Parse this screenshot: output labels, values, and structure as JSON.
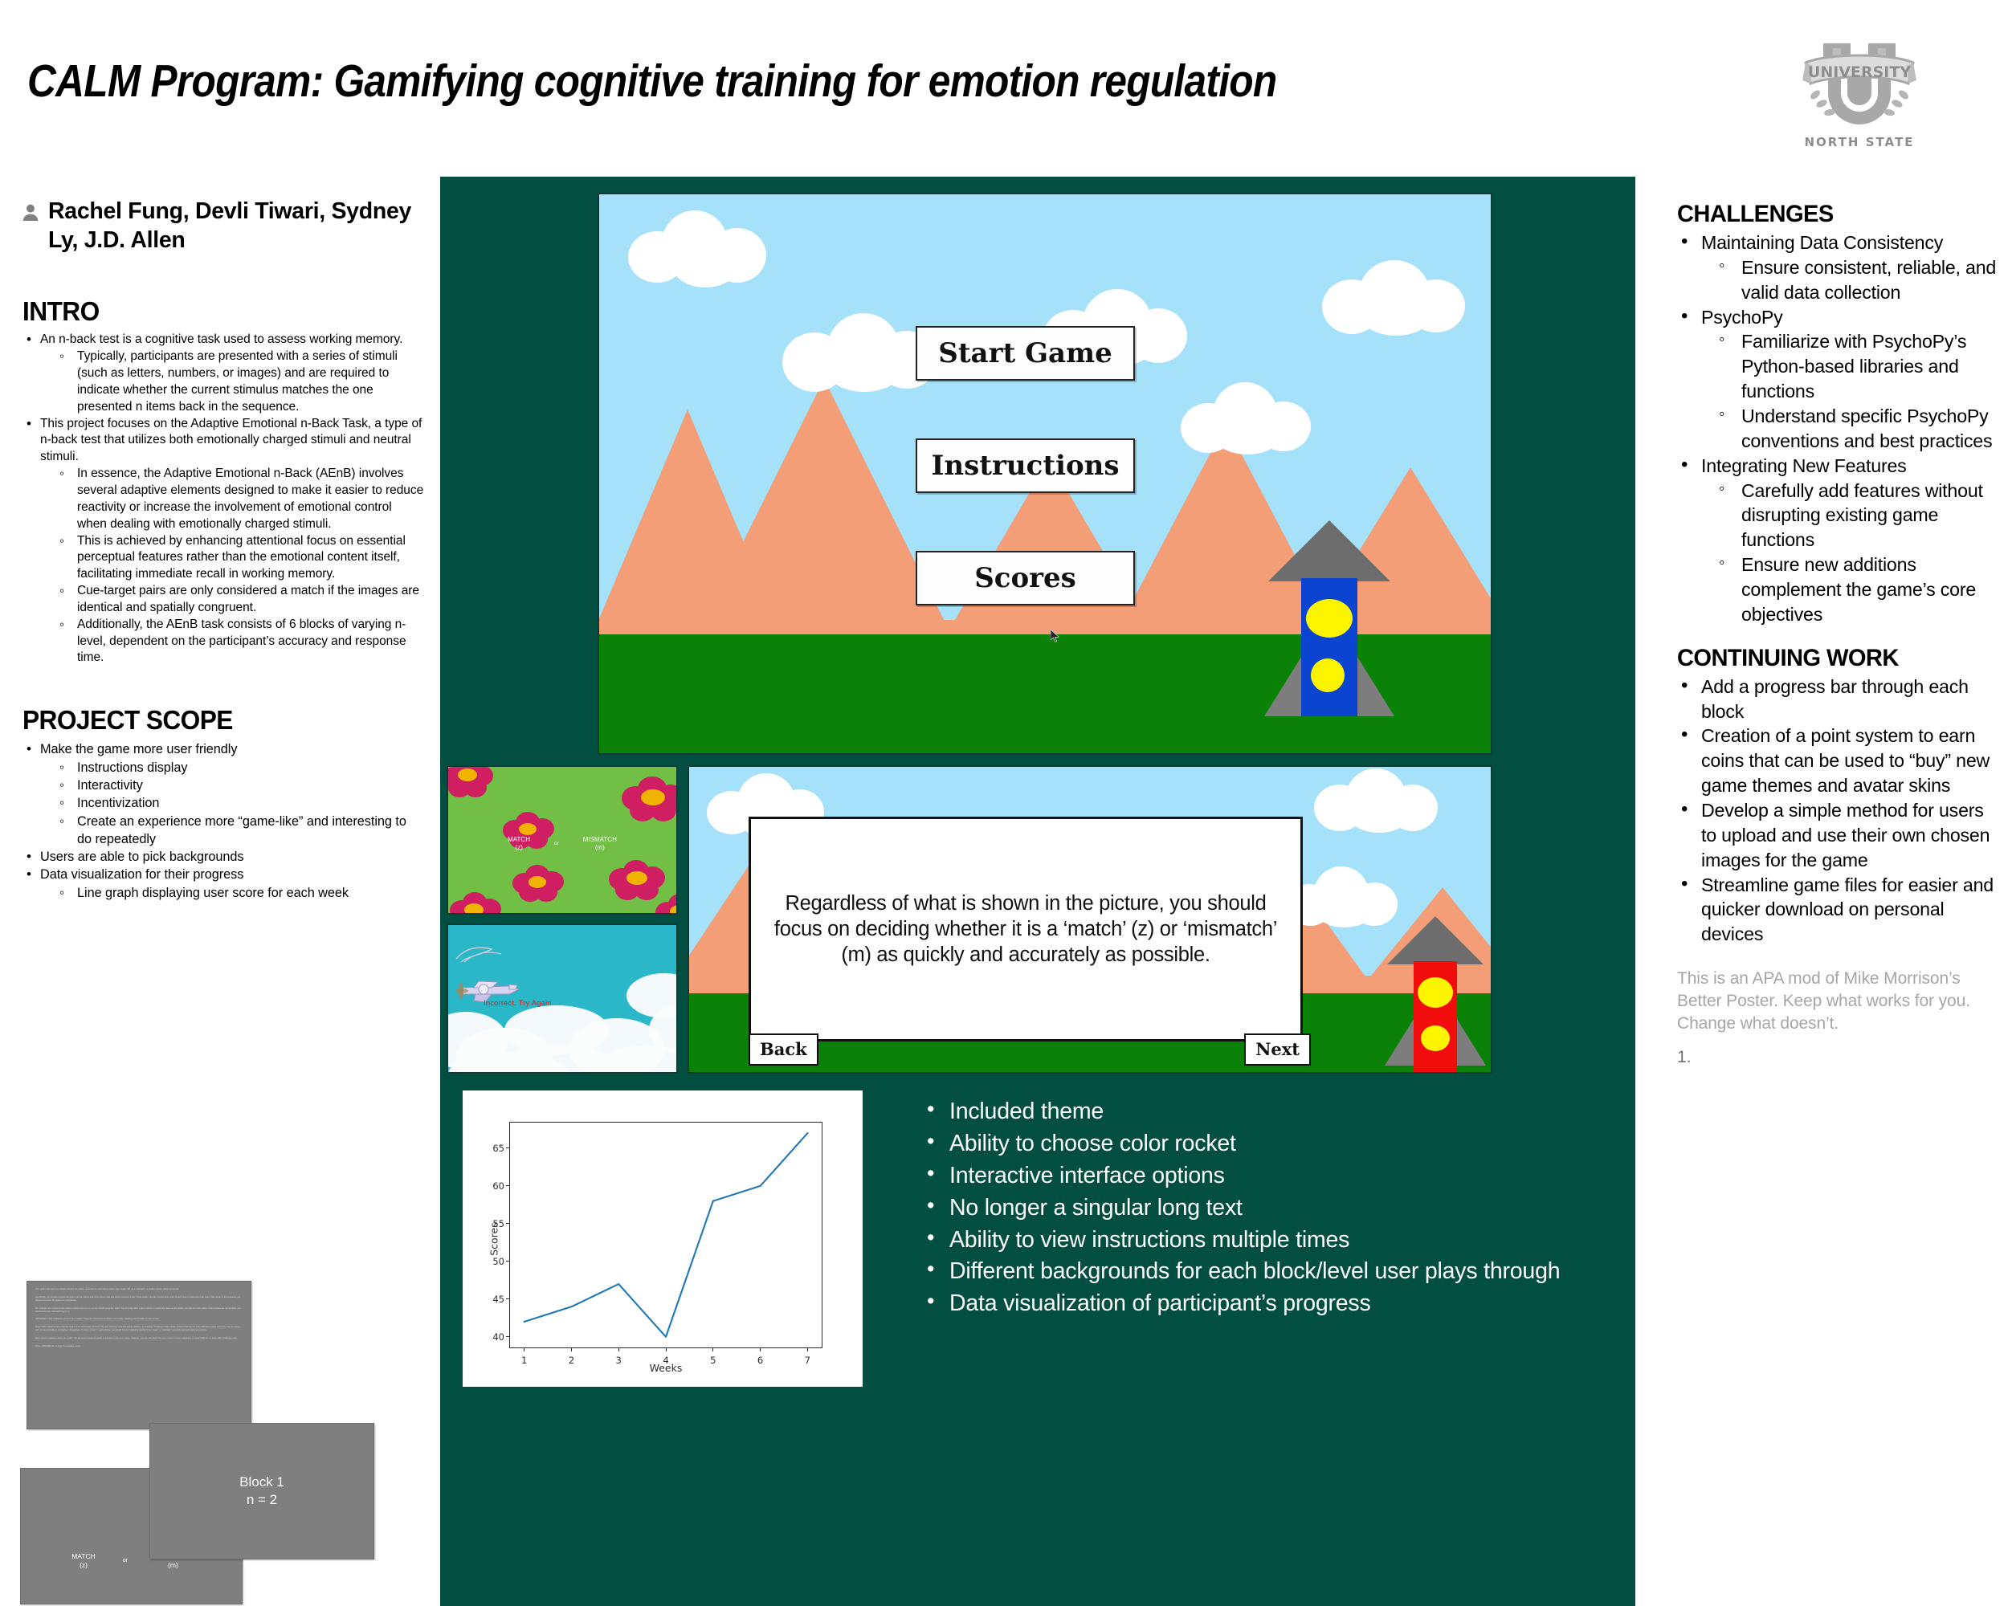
{
  "poster": {
    "title": "CALM Program: Gamifying cognitive training for emotion regulation",
    "authors": "Rachel Fung, Devli Tiwari, Sydney Ly, J.D. Allen",
    "logo": {
      "top_word": "UNIVERSITY",
      "bottom_word": "NORTH STATE",
      "monogram": "U"
    },
    "accent_teal": "#024f42"
  },
  "left_column": {
    "intro": {
      "heading": "INTRO",
      "bullets": [
        {
          "text": "An n-back test is a cognitive task used to assess working memory.",
          "sub": [
            "Typically, participants are presented with a series of stimuli (such as letters, numbers, or images) and are required to indicate whether the current stimulus matches the one presented n items back in the sequence."
          ]
        },
        {
          "text": "This project focuses on the Adaptive Emotional n-Back Task, a type of n-back test that utilizes both emotionally charged stimuli and neutral stimuli.",
          "sub": [
            " In essence, the Adaptive Emotional n-Back (AEnB) involves several adaptive elements designed to make it easier to reduce reactivity or increase the involvement of emotional control when dealing with emotionally charged stimuli.",
            "This is achieved by enhancing attentional focus on essential perceptual features rather than the emotional content itself, facilitating immediate recall in working memory.",
            "Cue-target pairs are only considered a match if the images are identical and spatially congruent.",
            "Additionally, the AEnB task consists of 6 blocks of varying n-level, dependent on the participant’s accuracy and response time."
          ]
        }
      ]
    },
    "project_scope": {
      "heading": "PROJECT SCOPE",
      "bullets": [
        {
          "text": "Make the game more user friendly",
          "sub": [
            "Instructions display",
            "Interactivity",
            "Incentivization",
            "Create an experience more “game-like” and interesting to do repeatedly"
          ]
        },
        {
          "text": "Users are able to pick backgrounds",
          "sub": []
        },
        {
          "text": "Data visualization for their progress",
          "sub": [
            "Line graph displaying user score for each week"
          ]
        }
      ]
    },
    "psychopy_screenshots": {
      "instructions_text": {
        "paragraphs": [
          "Your goal in this test is to indicate whether the picture presented on each trial is either: (1) a 'match' OR (2) a 'mismatch' to another picture shown previously.",
          "Specifically, you should compare the picture on the current trial to the picture that was shown between 1 and 7 trials earlier. Use the 'n-level' at the start of each round to determine how many trials earlier in the sequence you should remember the picture for comparison.",
          "For example, the n-level for the practice round is two (n = 2), so you should press the 'match' key ('z') only when a given picture is exactly the same as the picture you saw two trials earlier. If the pictures are not identical, you should press the 'mismatch' key ('m').",
          "IMPORTANT: Only respond to pictures as a 'match' if they are completely identical in every way, including their location on your screen.",
          "'Easy' trials include pictures that are meant to be memorable, because they are relatively more interesting, startling, or amusing. 'Challenge' trials contain pictures that may be more difficult to recall, since they may be boring, dull, or unremarkable in comparison. Regardless of what is shown in each picture, you should focus on deciding whether it is a 'match' or 'mismatch' as quickly and accurately as possible.",
          "Each correct response counts as 1 point. You will need at least 30 points to advance to the next n-level. However, you can only begin the next n-level if correct responses on 'easy' trials are no faster than 'challenge' trials.",
          "Press <SPACEBAR> to begin the practice round."
        ]
      },
      "block_screen": {
        "line1": "Block 1",
        "line2": "n = 2"
      },
      "match_screen": {
        "match": "MATCH",
        "match_key": "(z)",
        "or": "or",
        "mismatch": "MISMATCH",
        "mismatch_key": "(m)"
      }
    }
  },
  "center_panel": {
    "game_menu": {
      "buttons": [
        "Start Game",
        "Instructions",
        "Scores"
      ],
      "rocket_color": "#0b44d0",
      "sky_color": "#a5e1f8",
      "mountain_color": "#f49e78",
      "ground_color": "#0a8107"
    },
    "flower_screen": {
      "match": "MATCH",
      "match_key": "(z)",
      "or": "or",
      "mismatch": "MISMATCH",
      "mismatch_key": "(m)",
      "background_color": "#71bf44",
      "flower_color": "#cf1f62"
    },
    "cloud_screen": {
      "feedback": "Incorrect. Try Again",
      "feedback_color": "#e61414",
      "background_color": "#2ab8c8"
    },
    "instructions_screen": {
      "body": "Regardless of what is shown in the picture, you should focus on deciding whether it is a ‘match’ (z) or ‘mismatch’ (m) as quickly and accurately as possible.",
      "back_label": "Back",
      "next_label": "Next",
      "rocket_color": "#f20d0d"
    },
    "results_bullets": [
      "Included theme",
      "Ability to choose color rocket",
      "Interactive interface options",
      "No longer a singular long text",
      "Ability to view instructions multiple times",
      "Different backgrounds for each block/level user plays through",
      "Data visualization of participant’s progress"
    ]
  },
  "chart_data": {
    "type": "line",
    "title": "",
    "xlabel": "Weeks",
    "ylabel": "Scores",
    "x": [
      1,
      2,
      3,
      4,
      5,
      6,
      7
    ],
    "values": [
      42,
      44,
      47,
      40,
      58,
      60,
      67
    ],
    "xticks": [
      "1",
      "2",
      "3",
      "4",
      "5",
      "6",
      "7"
    ],
    "yticks": [
      "40",
      "45",
      "50",
      "55",
      "60",
      "65"
    ],
    "xlim": [
      0.7,
      7.3
    ],
    "ylim": [
      38.6,
      68.4
    ],
    "grid": false,
    "legend": false,
    "line_color": "#1f77b4"
  },
  "right_column": {
    "challenges": {
      "heading": "CHALLENGES",
      "bullets": [
        {
          "text": "Maintaining Data Consistency",
          "sub": [
            "Ensure consistent, reliable, and valid data collection"
          ]
        },
        {
          "text": "PsychoPy",
          "sub": [
            "Familiarize with PsychoPy’s Python-based libraries and functions",
            "Understand specific PsychoPy conventions and best practices"
          ]
        },
        {
          "text": "Integrating New Features",
          "sub": [
            "Carefully add features without disrupting existing game functions",
            "Ensure new additions complement the game’s core objectives"
          ]
        }
      ]
    },
    "continuing_work": {
      "heading": "CONTINUING WORK",
      "bullets": [
        {
          "text": "Add a progress bar through each block",
          "sub": []
        },
        {
          "text": "Creation of a point system to earn coins that can be used to “buy” new game themes and avatar skins",
          "sub": []
        },
        {
          "text": "Develop a simple method for users to upload and use their own chosen images for the game",
          "sub": []
        },
        {
          "text": "Streamline game files for easier and quicker download on personal devices",
          "sub": []
        }
      ]
    },
    "footer_note": "This is an APA mod of Mike Morrison’s Better Poster. Keep what works for you. Change what doesn’t.",
    "footer_number": "1."
  }
}
